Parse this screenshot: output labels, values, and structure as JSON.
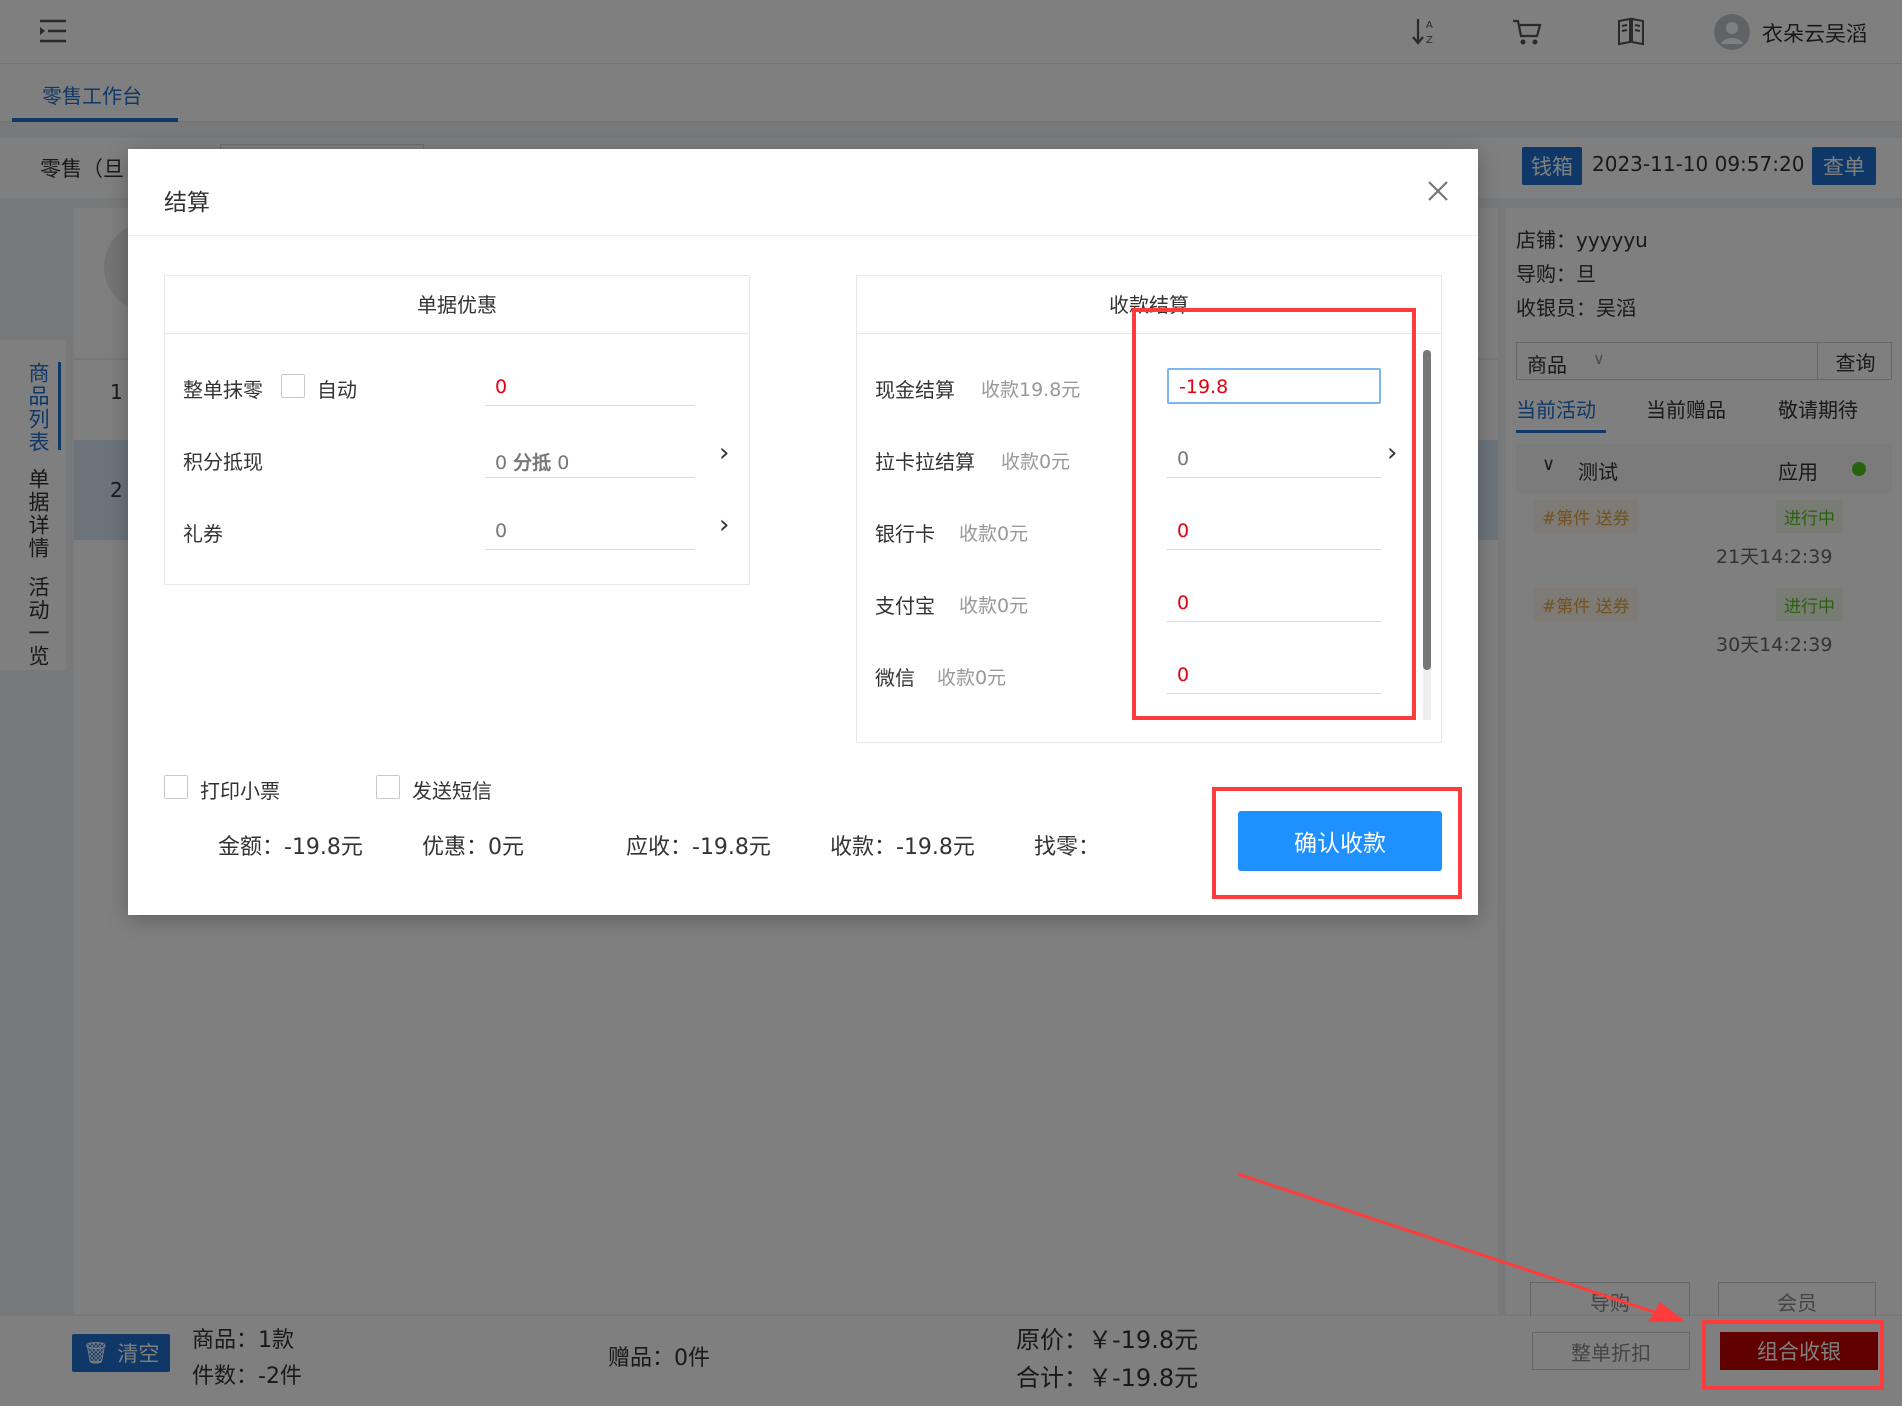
{
  "header": {
    "user_name": "衣朵云吴滔"
  },
  "tabs": [
    {
      "label": "零售工作台"
    }
  ],
  "workbar": {
    "mode_label": "零售（旦",
    "cashbox_label": "钱箱",
    "datetime": "2023-11-10 09:57:20",
    "query_order_label": "查单"
  },
  "left_sidebar": {
    "items": [
      {
        "label": "商品列表"
      },
      {
        "label": "单据详情"
      },
      {
        "label": "活动一览"
      }
    ]
  },
  "product_rows": [
    {
      "index": "1"
    },
    {
      "index": "2"
    }
  ],
  "right_panel": {
    "store": "店铺：yyyyyu",
    "guide": "导购：旦",
    "cashier": "收银员：吴滔",
    "search_type": "商品",
    "search_button": "查询",
    "tabs": [
      {
        "label": "当前活动"
      },
      {
        "label": "当前赠品"
      },
      {
        "label": "敬请期待"
      }
    ],
    "activity": {
      "name": "测试",
      "apply_label": "应用",
      "status_color": "#52c41a",
      "items": [
        {
          "tag": "#第件 送券",
          "status": "进行中",
          "time": "21天14:2:39"
        },
        {
          "tag": "#第件 送券",
          "status": "进行中",
          "time": "30天14:2:39"
        }
      ]
    },
    "buttons": {
      "guide": "导购",
      "member": "会员",
      "discount": "整单折扣",
      "combo_pay": "组合收银"
    }
  },
  "bottom_bar": {
    "clear_label": "清空",
    "goods": "商品：1款",
    "pieces": "件数：-2件",
    "gifts": "赠品：0件",
    "original_price": "原价：￥-19.8元",
    "total": "合计：￥-19.8元"
  },
  "modal": {
    "title": "结算",
    "discount_section": {
      "title": "单据优惠",
      "rows": [
        {
          "label": "整单抹零",
          "auto_label": "自动",
          "value": "0"
        },
        {
          "label": "积分抵现",
          "value_prefix": "0",
          "value_mid": "分抵",
          "value_suffix": "0"
        },
        {
          "label": "礼券",
          "value": "0"
        }
      ]
    },
    "payment_section": {
      "title": "收款结算",
      "rows": [
        {
          "label": "现金结算",
          "sub": "收款19.8元",
          "value": "-19.8"
        },
        {
          "label": "拉卡拉结算",
          "sub": "收款0元",
          "value": "0"
        },
        {
          "label": "银行卡",
          "sub": "收款0元",
          "value": "0"
        },
        {
          "label": "支付宝",
          "sub": "收款0元",
          "value": "0"
        },
        {
          "label": "微信",
          "sub": "收款0元",
          "value": "0"
        }
      ]
    },
    "options": {
      "print_receipt": "打印小票",
      "send_sms": "发送短信"
    },
    "summary": {
      "amount": "金额：-19.8元",
      "discount": "优惠：0元",
      "receivable": "应收：-19.8元",
      "received": "收款：-19.8元",
      "change": "找零："
    },
    "confirm_button": "确认收款"
  },
  "colors": {
    "primary": "#1e6fd0",
    "confirm": "#1e90ff",
    "annotation": "#ff3b3b",
    "combo_pay": "#c00000"
  }
}
